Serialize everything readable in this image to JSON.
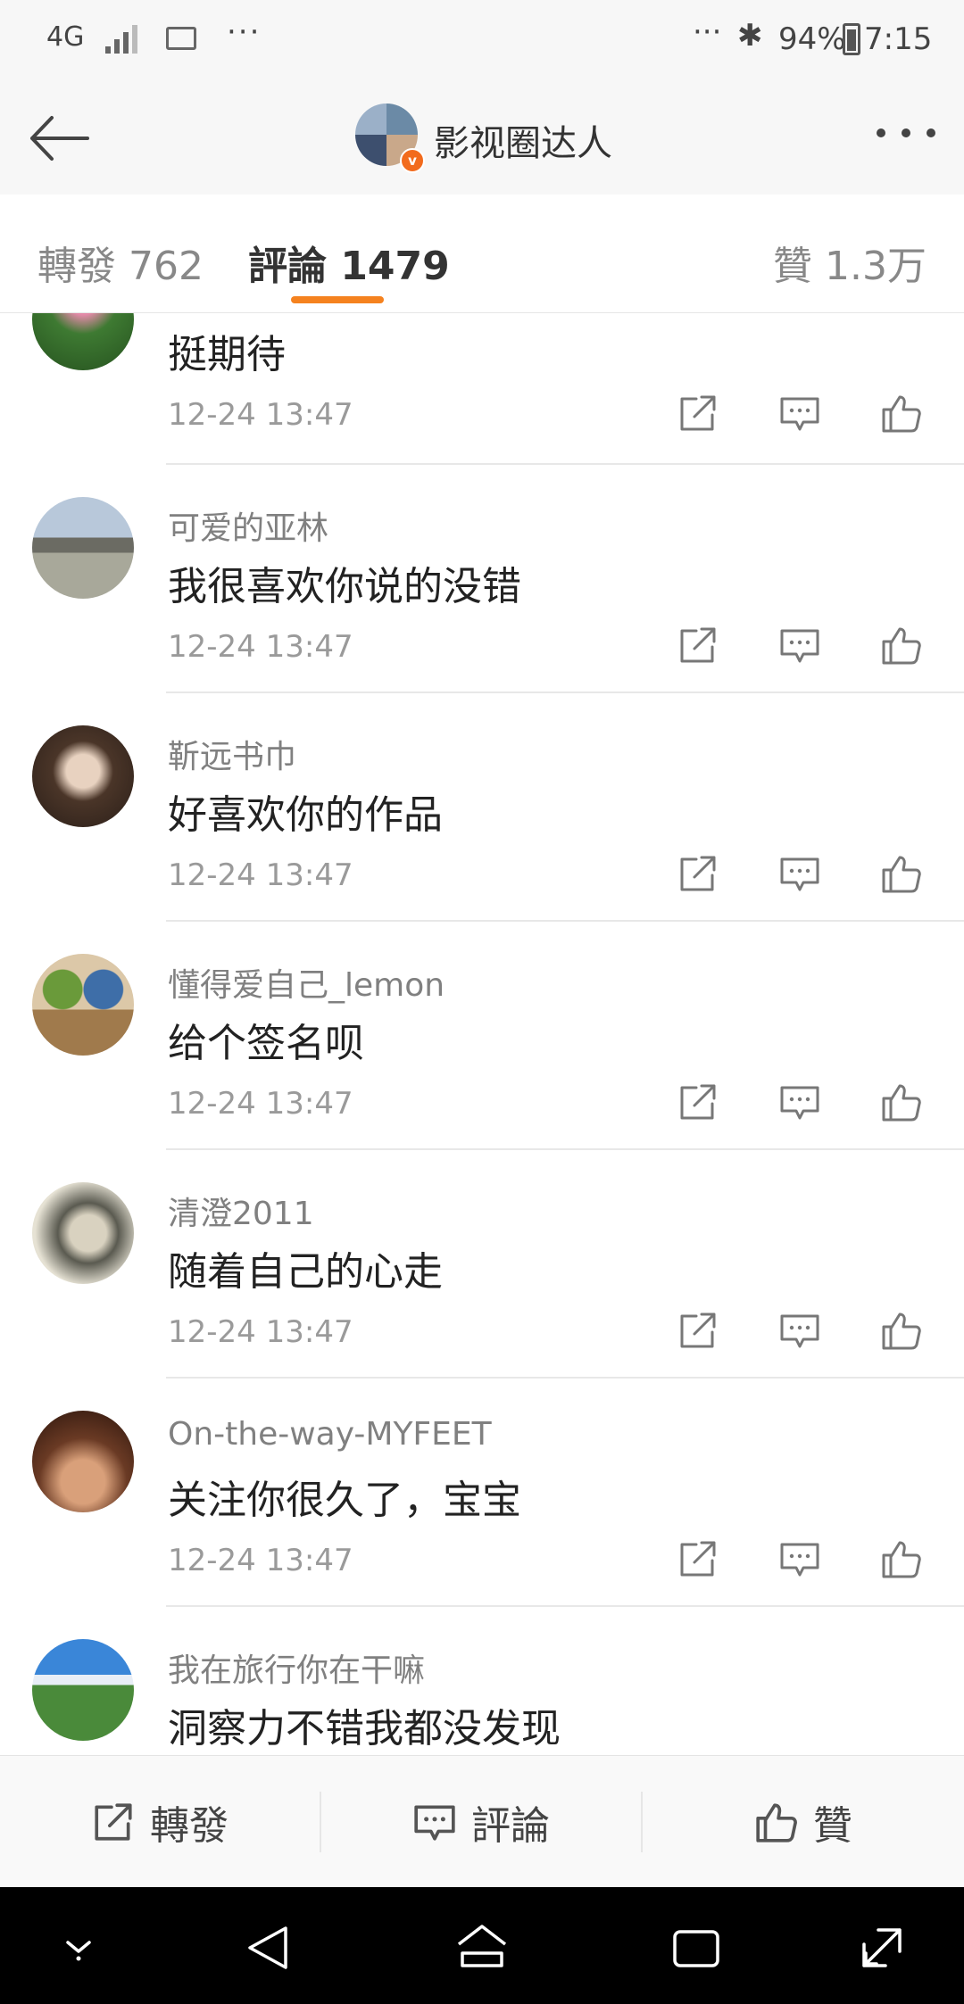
{
  "status_bar": {
    "network": "4G",
    "dots_left": "···",
    "dots_right": "···",
    "battery_percent": "94%",
    "time": "7:15",
    "icons": [
      "signal-icon",
      "image-icon",
      "bluetooth-icon",
      "battery-icon"
    ]
  },
  "header": {
    "title": "影视圈达人",
    "badge": "v",
    "back_icon": "arrow-left-icon",
    "more_icon": "more-dots-icon"
  },
  "tabs": {
    "repost": "轉發 762",
    "comment": "評論 1479",
    "like": "贊 1.3万",
    "active": "comment",
    "accent_color": "#f5821f"
  },
  "comments": [
    {
      "name": "",
      "text": "挺期待",
      "time": "12-24 13:47"
    },
    {
      "name": "可爱的亚林",
      "text": "我很喜欢你说的没错",
      "time": "12-24 13:47"
    },
    {
      "name": "靳远书巾",
      "text": "好喜欢你的作品",
      "time": "12-24 13:47"
    },
    {
      "name": "懂得爱自己_lemon",
      "text": "给个签名呗",
      "time": "12-24 13:47"
    },
    {
      "name": "清澄2011",
      "text": "随着自己的心走",
      "time": "12-24 13:47"
    },
    {
      "name": "On-the-way-MYFEET",
      "text": "关注你很久了，宝宝",
      "time": "12-24 13:47"
    },
    {
      "name": "我在旅行你在干嘛",
      "text": "洞察力不错我都没发现",
      "time": ""
    }
  ],
  "action_bar": {
    "repost": "轉發",
    "comment": "評論",
    "like": "贊"
  },
  "nav_bar": {
    "icons": [
      "chevron-down-icon",
      "back-triangle-icon",
      "home-icon",
      "recents-icon",
      "expand-icon"
    ]
  }
}
